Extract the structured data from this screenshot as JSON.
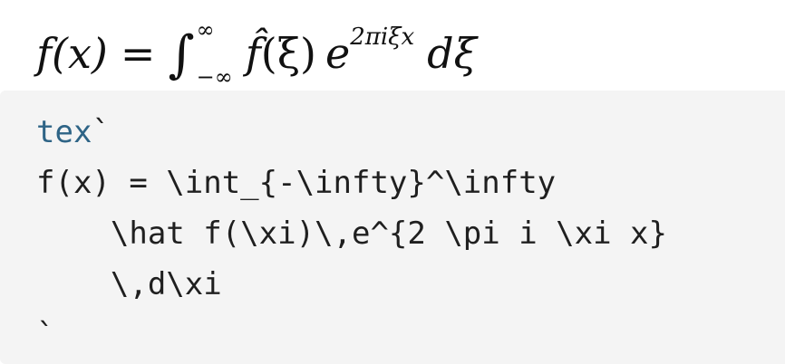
{
  "formula": {
    "lhs": "f(x)",
    "equals": "=",
    "integral": "∫",
    "upper": "∞",
    "lower": "−∞",
    "hat_f": "f̂",
    "arg": "(ξ)",
    "base": "e",
    "exponent": "2πiξx",
    "d": "d",
    "var": "ξ"
  },
  "code": {
    "language": "tex",
    "open_fence": "`",
    "lines": [
      "f(x) = \\int_{-\\infty}^\\infty",
      "    \\hat f(\\xi)\\,e^{2 \\pi i \\xi x}",
      "    \\,d\\xi"
    ],
    "close_fence": "`"
  }
}
